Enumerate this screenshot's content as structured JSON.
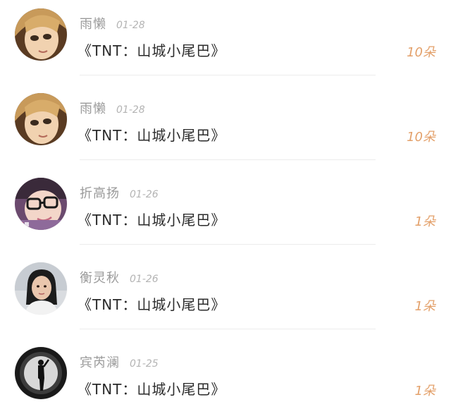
{
  "colors": {
    "username": "#9a9a9a",
    "date": "#b4b4b4",
    "gift_text": "#2a2a2a",
    "count": "#e3a06a",
    "divider": "#ececec"
  },
  "gift_records": [
    {
      "avatar_icon": "avatar-blonde-girl-icon",
      "username": "雨懒",
      "date": "01-28",
      "gift": "《TNT：山城小尾巴》",
      "count": "10朵"
    },
    {
      "avatar_icon": "avatar-blonde-girl-icon",
      "username": "雨懒",
      "date": "01-28",
      "gift": "《TNT：山城小尾巴》",
      "count": "10朵"
    },
    {
      "avatar_icon": "avatar-glasses-girl-icon",
      "username": "折高扬",
      "date": "01-26",
      "gift": "《TNT：山城小尾巴》",
      "count": "1朵"
    },
    {
      "avatar_icon": "avatar-girl-photo-icon",
      "username": "衡灵秋",
      "date": "01-26",
      "gift": "《TNT：山城小尾巴》",
      "count": "1朵"
    },
    {
      "avatar_icon": "avatar-silhouette-icon",
      "username": "宾芮澜",
      "date": "01-25",
      "gift": "《TNT：山城小尾巴》",
      "count": "1朵"
    }
  ]
}
